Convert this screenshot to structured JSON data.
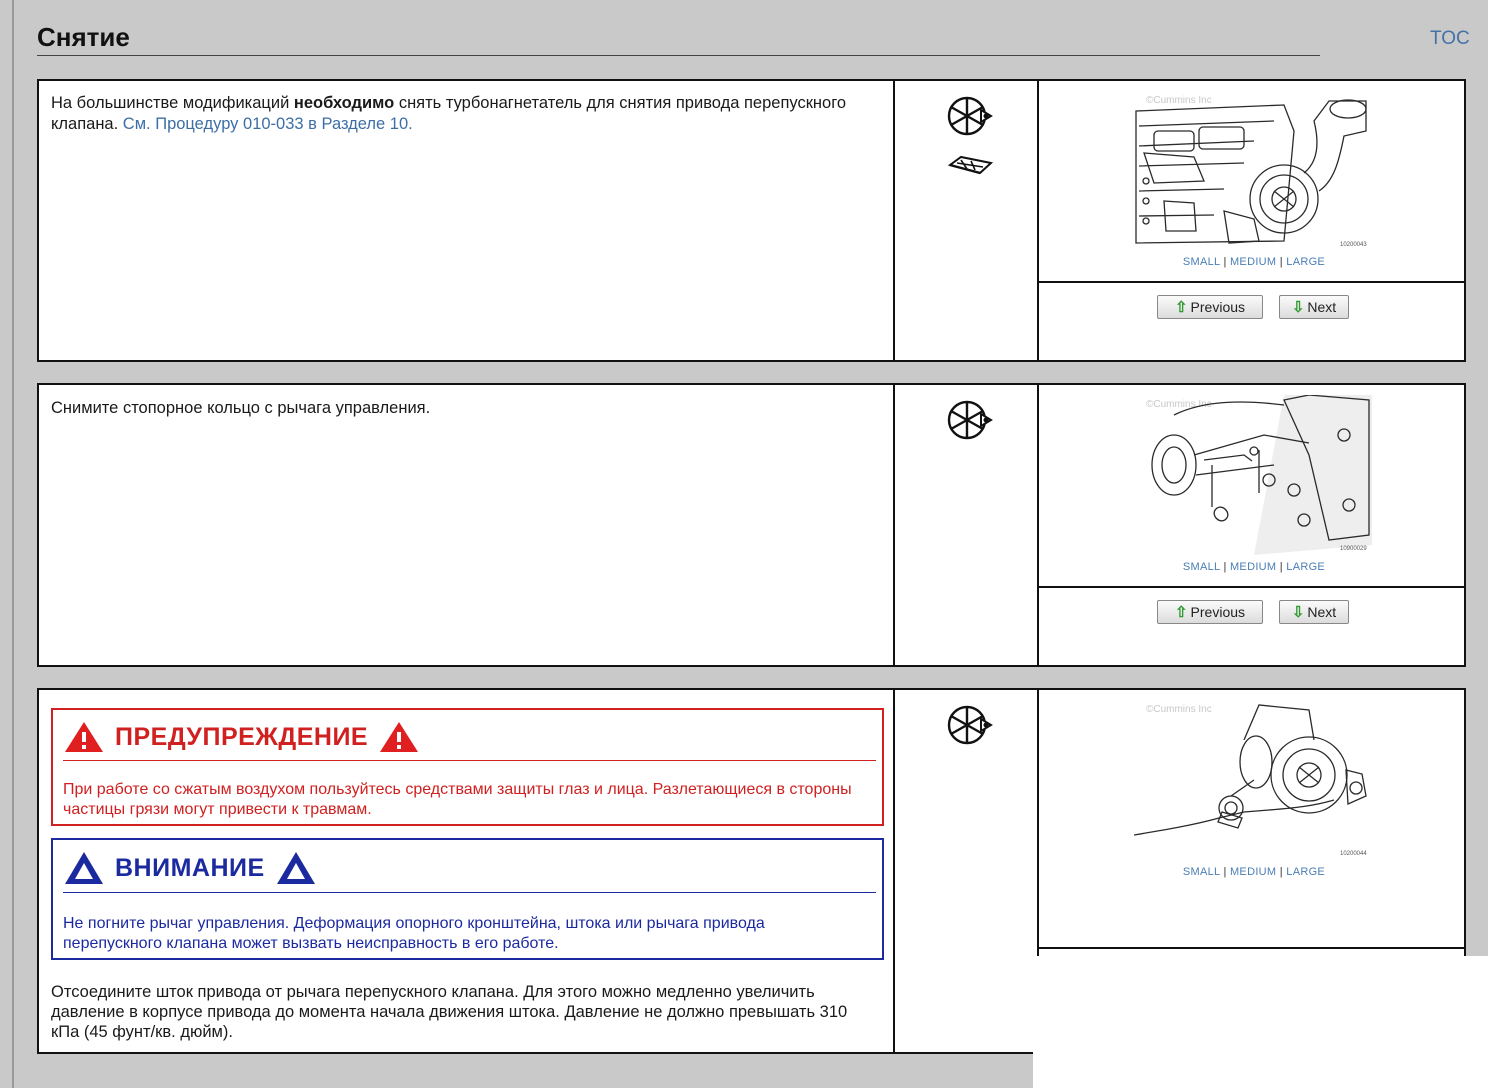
{
  "header": {
    "title": "Снятие",
    "toc_label": "TOC"
  },
  "colors": {
    "link": "#3d6fa5",
    "warning": "#d02020",
    "caution": "#1c2aa0",
    "button_arrow": "#2f9a2f"
  },
  "figure_size_links": {
    "small": "SMALL",
    "medium": "MEDIUM",
    "large": "LARGE",
    "separator": "|"
  },
  "nav_buttons": {
    "previous": "Previous",
    "next": "Next"
  },
  "steps": [
    {
      "text_before": "На большинстве модификаций ",
      "text_bold": "необходимо",
      "text_after": " снять турбонагнетатель для снятия привода перепускного клапана. ",
      "link_text": "См. Процедуру 010-033 в Разделе 10.",
      "icons": [
        "remove-symbol-icon",
        "hardware-symbol-icon"
      ],
      "figure": {
        "watermark": "©Cummins Inc",
        "code": "10200043",
        "subject": "turbocharger-on-engine"
      }
    },
    {
      "text": "Снимите стопорное кольцо с рычага управления.",
      "icons": [
        "remove-symbol-icon"
      ],
      "figure": {
        "watermark": "©Cummins Inc",
        "code": "10900029",
        "subject": "control-lever-retaining-ring"
      }
    },
    {
      "warning": {
        "title": "ПРЕДУПРЕЖДЕНИЕ",
        "text": "При работе со сжатым воздухом пользуйтесь средствами защиты глаз и лица. Разлетающиеся в стороны частицы грязи могут привести к травмам."
      },
      "caution": {
        "title": "ВНИМАНИЕ",
        "text": "Не погните рычаг управления. Деформация опорного кронштейна, штока или рычага привода перепускного клапана может вызвать неисправность в его работе."
      },
      "text": "Отсоедините шток привода от рычага перепускного клапана. Для этого можно медленно увеличить давление в корпусе привода до момента начала движения штока. Давление не должно превышать 310 кПа (45 фунт/кв. дюйм).",
      "icons": [
        "remove-symbol-icon"
      ],
      "figure": {
        "watermark": "©Cummins Inc",
        "code": "10200044",
        "subject": "turbocharger-with-air-regulator"
      }
    }
  ]
}
